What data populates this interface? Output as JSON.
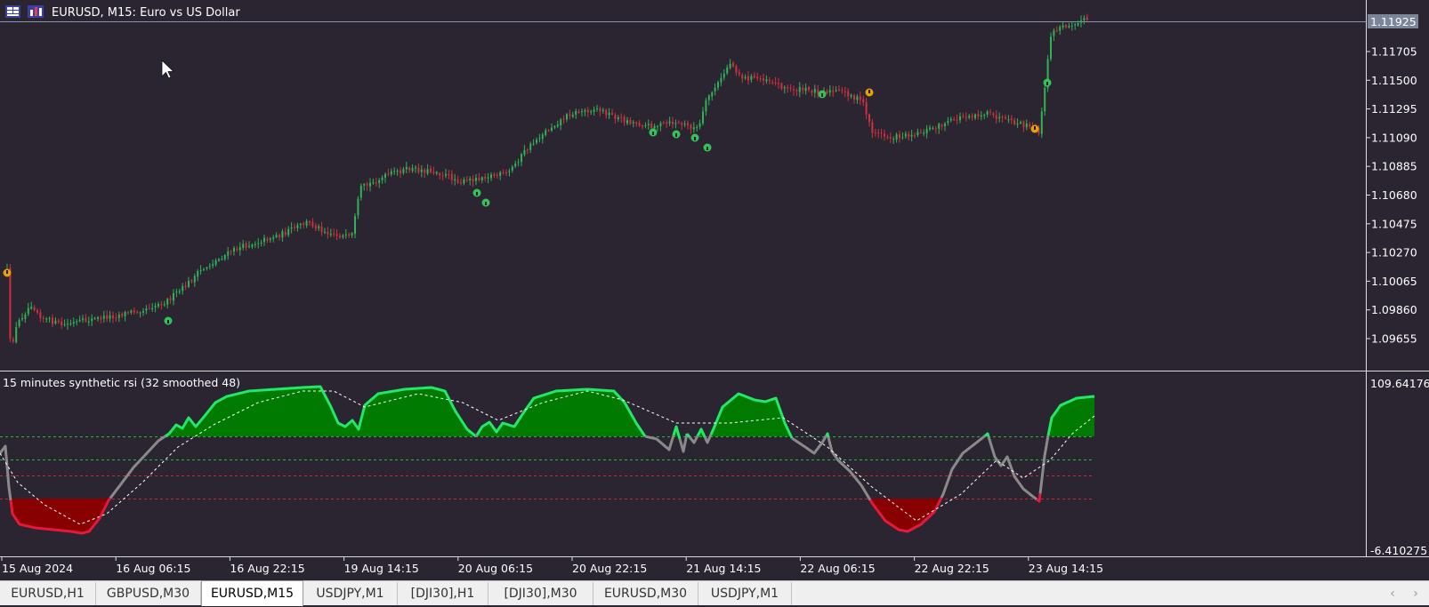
{
  "window": {
    "title": "EURUSD, M15:  Euro vs US Dollar"
  },
  "main_chart": {
    "price_labels": [
      "1.11705",
      "1.11500",
      "1.11295",
      "1.11090",
      "1.10885",
      "1.10680",
      "1.10475",
      "1.10270",
      "1.10065",
      "1.09860",
      "1.09655"
    ],
    "current_price": "1.11925"
  },
  "indicator": {
    "name": "15 minutes synthetic rsi (32 smoothed 48)",
    "max_label": "109.641768",
    "min_label": "-6.410275"
  },
  "time_axis": {
    "labels": [
      "15 Aug 2024",
      "16 Aug 06:15",
      "16 Aug 22:15",
      "19 Aug 14:15",
      "20 Aug 06:15",
      "20 Aug 22:15",
      "21 Aug 14:15",
      "22 Aug 06:15",
      "22 Aug 22:15",
      "23 Aug 14:15"
    ]
  },
  "tabs": [
    "EURUSD,H1",
    "GBPUSD,M30",
    "EURUSD,M15",
    "USDJPY,M1",
    "[DJI30],H1",
    "[DJI30],M30",
    "EURUSD,M30",
    "USDJPY,M1"
  ],
  "active_tab": "EURUSD,M15",
  "colors": {
    "background": "#2a2530",
    "bull": "#2fb356",
    "bear": "#d0303f",
    "rsi_high_fill": "#007a00",
    "rsi_high_line": "#22e86a",
    "rsi_low_fill": "#880000",
    "rsi_low_line": "#e8183c",
    "rsi_mid": "#8a8a8a",
    "signal_up": "#2fc45a",
    "signal_down": "#e8a000"
  }
}
